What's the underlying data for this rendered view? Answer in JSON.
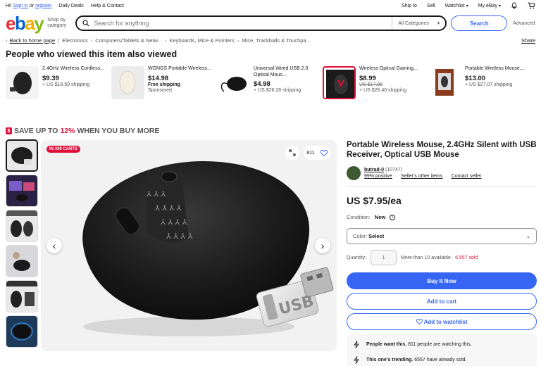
{
  "topbar": {
    "greeting": "Hi!",
    "sign_in": "Sign in",
    "or": "or",
    "register": "register",
    "daily_deals": "Daily Deals",
    "help": "Help & Contact",
    "ship_to": "Ship to",
    "sell": "Sell",
    "watchlist": "Watchlist",
    "my_ebay": "My eBay"
  },
  "header": {
    "logo": [
      "e",
      "b",
      "a",
      "y"
    ],
    "shop_by": "Shop by category",
    "search_placeholder": "Search for anything",
    "category": "All Categories",
    "search_button": "Search",
    "advanced": "Advanced"
  },
  "breadcrumb": {
    "back": "Back to home page",
    "items": [
      "Electronics",
      "Computers/Tablets & Netw...",
      "Keyboards, Mice & Pointers",
      "Mice, Trackballs & Touchpa..."
    ],
    "share": "Share"
  },
  "also_viewed": {
    "title": "People who viewed this item also viewed",
    "items": [
      {
        "name": "2.4GHz Wireless Cordless...",
        "price": "$9.39",
        "orig": "",
        "ship": "+ US $18.59 shipping",
        "extra": ""
      },
      {
        "name": "WONGS Portable Wireless...",
        "price": "$14.98",
        "orig": "",
        "ship": "Free shipping",
        "extra": "Sponsored"
      },
      {
        "name": "Universal Wired USB 2.0 Optical Mous...",
        "price": "$4.98",
        "orig": "",
        "ship": "+ US $26.28 shipping",
        "extra": ""
      },
      {
        "name": "Wireless Optical Gaming...",
        "price": "$8.99",
        "orig": "US $17.98",
        "ship": "+ US $26.40 shipping",
        "extra": ""
      },
      {
        "name": "Portable Wireless Mouse,...",
        "price": "$13.00",
        "orig": "",
        "ship": "+ US $27.07 shipping",
        "extra": ""
      }
    ]
  },
  "promo": {
    "prefix": "SAVE UP TO",
    "pct": "12%",
    "suffix": "WHEN YOU BUY MORE"
  },
  "gallery": {
    "in_carts": "IN 339 CARTS",
    "watchers": "811"
  },
  "product": {
    "title": "Portable Wireless Mouse, 2.4GHz Silent with USB Receiver, Optical USB Mouse",
    "seller_name": "butrad-0",
    "seller_count": "(10747)",
    "positive": "99% positive",
    "other_items": "Seller's other items",
    "contact": "Contact seller",
    "price": "US $7.95/ea",
    "condition_label": "Condition:",
    "condition": "New",
    "color_label": "Color:",
    "color_value": "Select",
    "qty_label": "Quantity:",
    "qty_value": "1",
    "available": "More than 10 available",
    "sold": "6,557 sold",
    "buy_now": "Buy It Now",
    "add_cart": "Add to cart",
    "add_watch": "Add to watchlist",
    "signal1_b": "People want this.",
    "signal1": "811 people are watching this.",
    "signal2_b": "This one's trending.",
    "signal2": "6557 have already sold."
  }
}
